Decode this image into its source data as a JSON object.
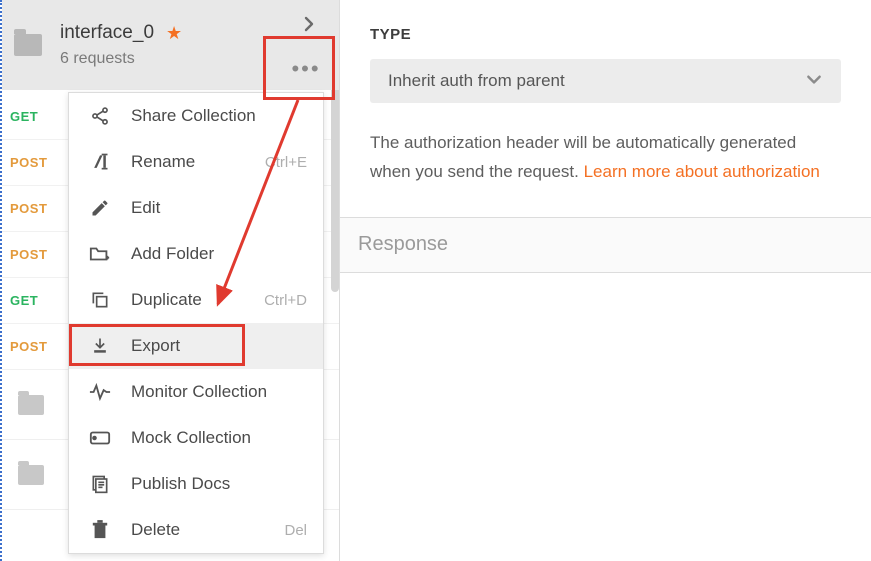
{
  "sidebar": {
    "collection": {
      "name": "interface_0",
      "sub": "6 requests"
    },
    "requests": [
      {
        "method": "GET"
      },
      {
        "method": "POST"
      },
      {
        "method": "POST"
      },
      {
        "method": "POST"
      },
      {
        "method": "GET"
      },
      {
        "method": "POST"
      }
    ]
  },
  "context_menu": {
    "items": [
      {
        "icon": "share-icon",
        "label": "Share Collection",
        "shortcut": ""
      },
      {
        "icon": "rename-icon",
        "label": "Rename",
        "shortcut": "Ctrl+E"
      },
      {
        "icon": "edit-icon",
        "label": "Edit",
        "shortcut": ""
      },
      {
        "icon": "add-folder-icon",
        "label": "Add Folder",
        "shortcut": ""
      },
      {
        "icon": "duplicate-icon",
        "label": "Duplicate",
        "shortcut": "Ctrl+D"
      },
      {
        "icon": "export-icon",
        "label": "Export",
        "shortcut": ""
      },
      {
        "icon": "monitor-icon",
        "label": "Monitor Collection",
        "shortcut": ""
      },
      {
        "icon": "mock-icon",
        "label": "Mock Collection",
        "shortcut": ""
      },
      {
        "icon": "publish-icon",
        "label": "Publish Docs",
        "shortcut": ""
      },
      {
        "icon": "delete-icon",
        "label": "Delete",
        "shortcut": "Del"
      }
    ]
  },
  "right": {
    "type_label": "TYPE",
    "auth_select_value": "Inherit auth from parent",
    "auth_help_text": "The authorization header will be automatically generated when you send the request. ",
    "auth_help_link": "Learn more about authorization",
    "response_label": "Response"
  }
}
